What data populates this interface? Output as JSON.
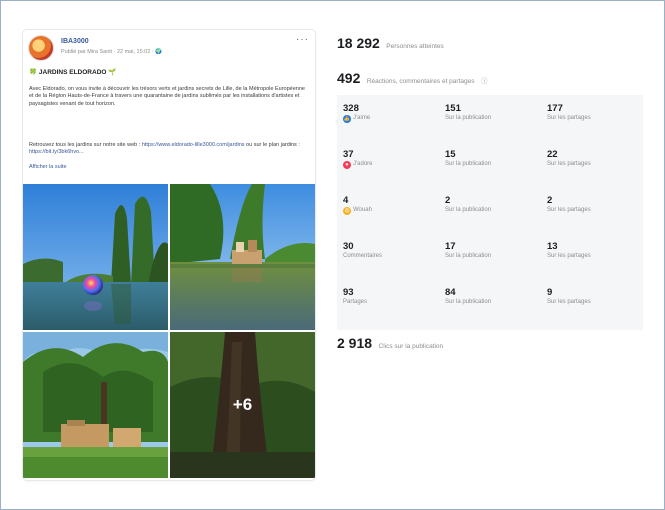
{
  "post": {
    "page_name": "IBA3000",
    "meta": "Publié par Mira Santi ⁠· 22 mai, 15:02 · 🌍",
    "more_label": "···",
    "title": "JARDINS ELDORADO",
    "text": "Avec Eldorado, on vous invite à découvrir les trésors verts et jardins secrets de Lille, de la Métropole Européenne et de la Région Hauts-de-France à travers une quarantaine de jardins sublimés par les installations d'artistes et paysagistes venant de tout horizon.",
    "links_intro": "Retrouvez tous les jardins sur notre site web : ",
    "link1": "https://www.eldorado-lille3000.com/jardins",
    "links_mid": " ou sur le plan jardins : ",
    "link2": "https://bit.ly/3bk6hvo...",
    "see_more": "Afficher la suite",
    "extra_photos": "+6"
  },
  "insights": {
    "reach": {
      "value": "18 292",
      "label": "Personnes atteintes"
    },
    "engagement": {
      "value": "492",
      "label": "Réactions, commentaires et partages",
      "info_icon": "ⓘ"
    },
    "clicks": {
      "value": "2 918",
      "label": "Clics sur la publication"
    },
    "rows": [
      {
        "total": "328",
        "label": "J'aime",
        "icon": "like-icon",
        "post_value": "151",
        "post_label": "Sur la publication",
        "share_value": "177",
        "share_label": "Sur les partages"
      },
      {
        "total": "37",
        "label": "J'adore",
        "icon": "love-icon",
        "post_value": "15",
        "post_label": "Sur la publication",
        "share_value": "22",
        "share_label": "Sur les partages"
      },
      {
        "total": "4",
        "label": "Wouah",
        "icon": "wow-icon",
        "post_value": "2",
        "post_label": "Sur la publication",
        "share_value": "2",
        "share_label": "Sur les partages"
      },
      {
        "total": "30",
        "label": "Commentaires",
        "icon": "",
        "post_value": "17",
        "post_label": "Sur la publication",
        "share_value": "13",
        "share_label": "Sur les partages"
      },
      {
        "total": "93",
        "label": "Partages",
        "icon": "",
        "post_value": "84",
        "post_label": "Sur la publication",
        "share_value": "9",
        "share_label": "Sur les partages"
      }
    ]
  },
  "colors": {
    "like": "#1877f2",
    "love": "#f33e58",
    "wow": "#f7b125",
    "link": "#385898"
  }
}
